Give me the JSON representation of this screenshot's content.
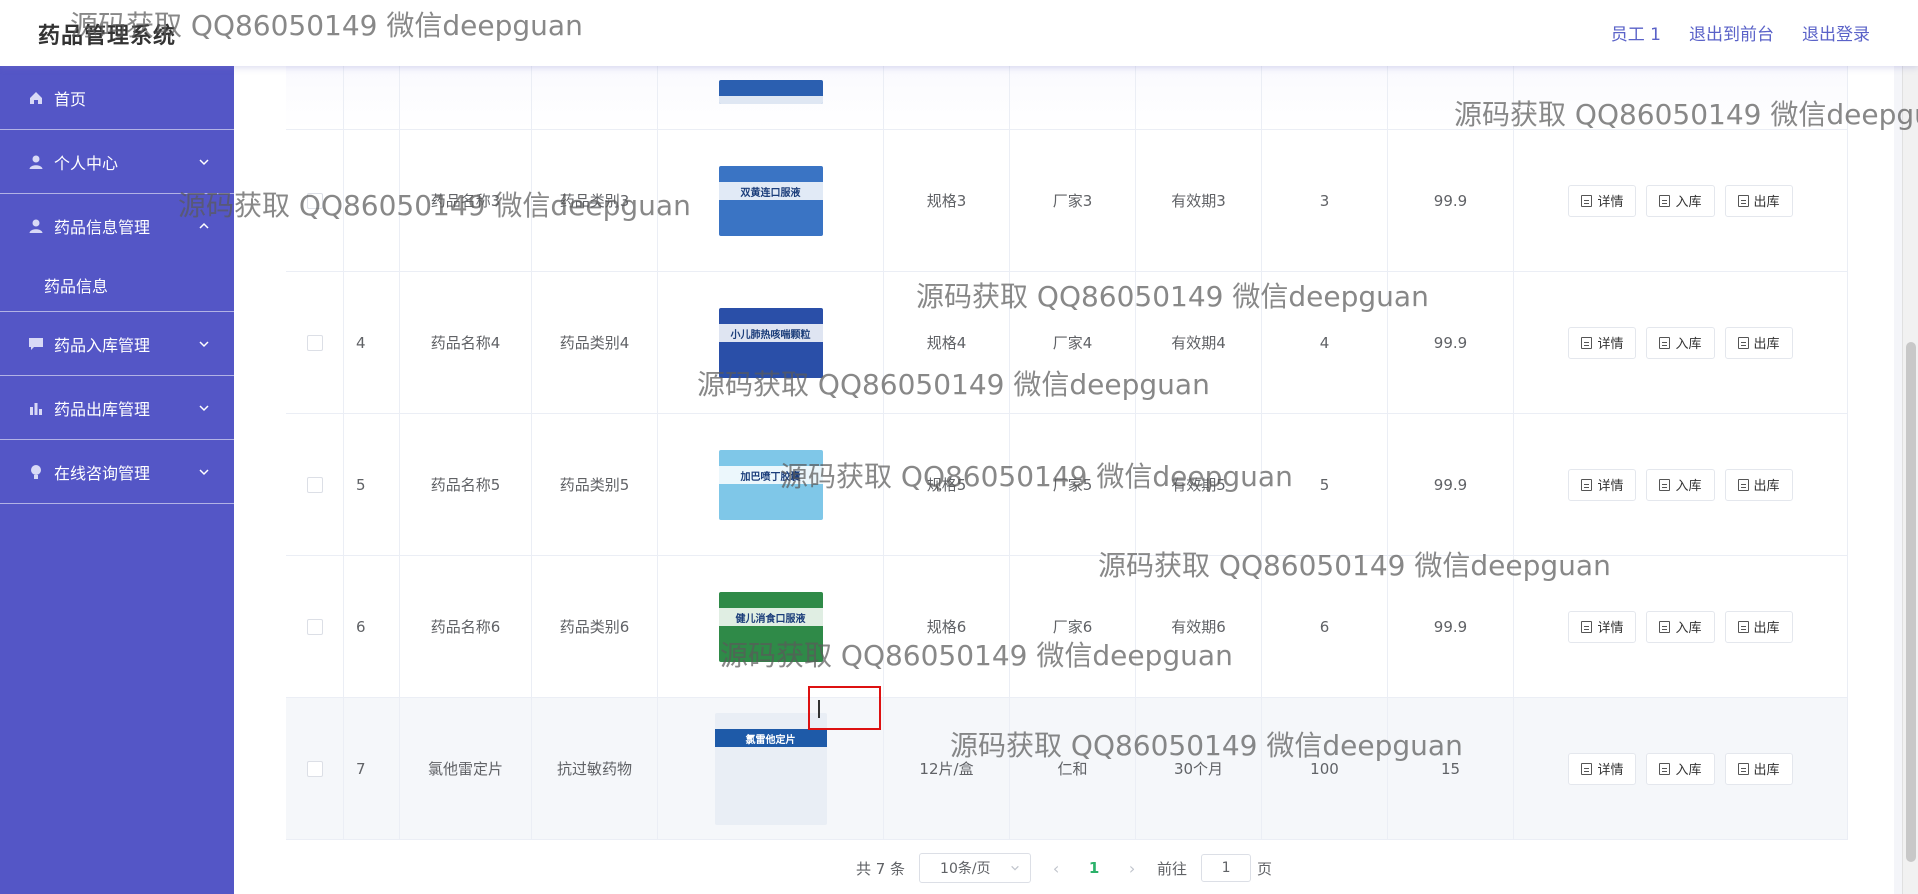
{
  "app": {
    "title": "药品管理系统",
    "nav": [
      "员工 1",
      "退出到前台",
      "退出登录"
    ]
  },
  "sidebar": {
    "items": [
      {
        "label": "首页",
        "icon": "home-icon",
        "has_arrow": false
      },
      {
        "label": "个人中心",
        "icon": "user-icon",
        "has_arrow": true,
        "arrow": "down"
      },
      {
        "label": "药品信息管理",
        "icon": "user-icon",
        "has_arrow": true,
        "arrow": "up"
      },
      {
        "label": "药品信息",
        "sub": true
      },
      {
        "label": "药品入库管理",
        "icon": "chat-icon",
        "has_arrow": true,
        "arrow": "down"
      },
      {
        "label": "药品出库管理",
        "icon": "bar-chart-icon",
        "has_arrow": true,
        "arrow": "down"
      },
      {
        "label": "在线咨询管理",
        "icon": "bulb-icon",
        "has_arrow": true,
        "arrow": "down"
      }
    ]
  },
  "table": {
    "rows": [
      {
        "index": "",
        "name": "",
        "category": "",
        "spec": "",
        "maker": "",
        "expiry": "",
        "stock": "",
        "price": "",
        "thumb_color": "#2b5fb0",
        "partial": true
      },
      {
        "index": "",
        "name": "药品名称3",
        "category": "药品类别3",
        "spec": "规格3",
        "maker": "厂家3",
        "expiry": "有效期3",
        "stock": "3",
        "price": "99.9",
        "thumb_color": "#3a74c4",
        "thumb_label": "双黄连口服液"
      },
      {
        "index": "4",
        "name": "药品名称4",
        "category": "药品类别4",
        "spec": "规格4",
        "maker": "厂家4",
        "expiry": "有效期4",
        "stock": "4",
        "price": "99.9",
        "thumb_color": "#2a4fa8",
        "thumb_label": "小儿肺热咳喘颗粒"
      },
      {
        "index": "5",
        "name": "药品名称5",
        "category": "药品类别5",
        "spec": "规格5",
        "maker": "厂家5",
        "expiry": "有效期5",
        "stock": "5",
        "price": "99.9",
        "thumb_color": "#7fc7e8",
        "thumb_label": "加巴喷丁胶囊"
      },
      {
        "index": "6",
        "name": "药品名称6",
        "category": "药品类别6",
        "spec": "规格6",
        "maker": "厂家6",
        "expiry": "有效期6",
        "stock": "6",
        "price": "99.9",
        "thumb_color": "#2f8a48",
        "thumb_label": "健儿消食口服液"
      },
      {
        "index": "7",
        "name": "氯他雷定片",
        "category": "抗过敏药物",
        "spec": "12片/盒",
        "maker": "仁和",
        "expiry": "30个月",
        "stock": "100",
        "price": "15",
        "thumb_color": "#e9eef5",
        "thumb_label": "氯雷他定片"
      }
    ],
    "actions": [
      "详情",
      "入库",
      "出库"
    ]
  },
  "pager": {
    "total": "共 7 条",
    "page_size": "10条/页",
    "current": "1",
    "goto_prefix": "前往",
    "goto_value": "1",
    "goto_suffix": "页"
  },
  "watermark": "源码获取 QQ86050149 微信deepguan",
  "colors": {
    "sidebar": "#5456c6",
    "accent": "#5a62c8",
    "active_page": "#2bb16a"
  }
}
